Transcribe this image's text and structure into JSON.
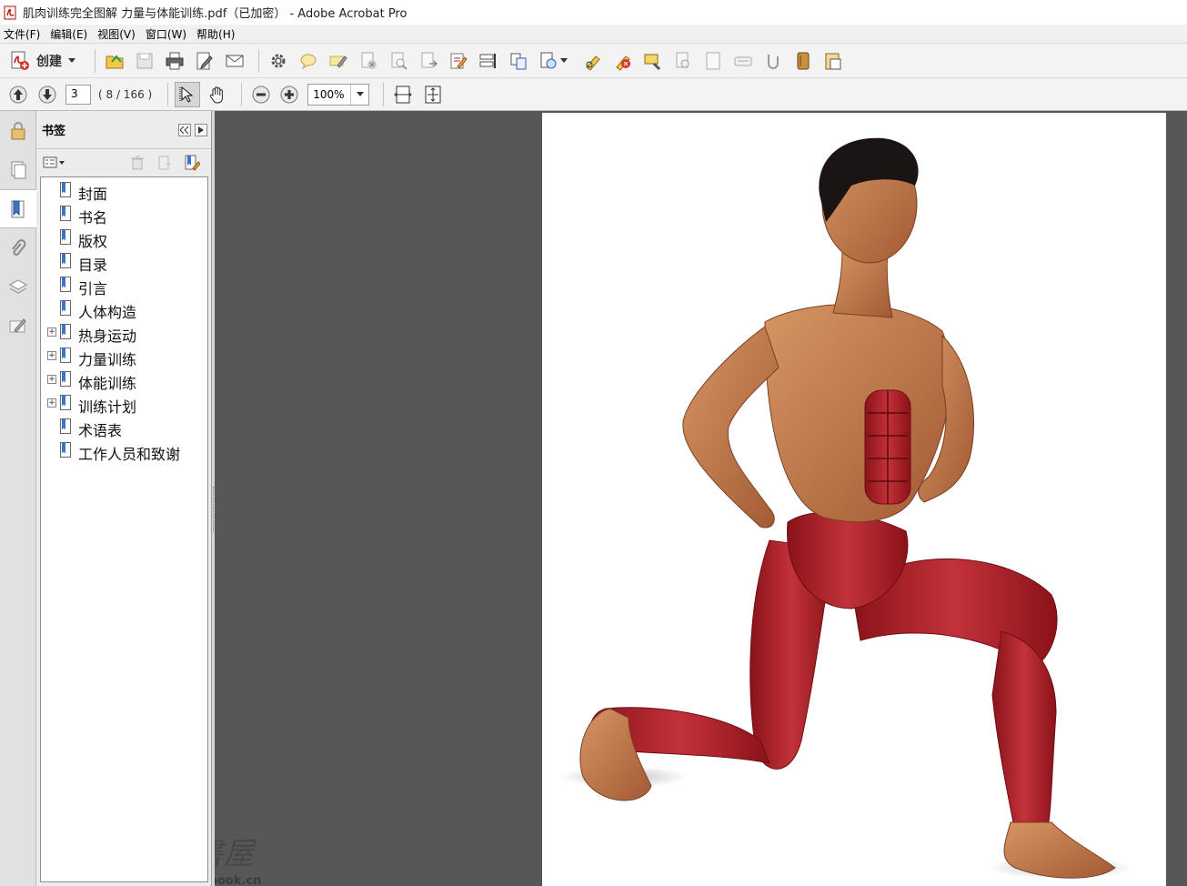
{
  "window": {
    "title": "肌肉训练完全图解 力量与体能训练.pdf（已加密） - Adobe Acrobat Pro"
  },
  "menu": [
    "文件(F)",
    "编辑(E)",
    "视图(V)",
    "窗口(W)",
    "帮助(H)"
  ],
  "toolbar": {
    "create_label": "创建"
  },
  "nav": {
    "page_input": "3",
    "page_count": "( 8 / 166 )",
    "zoom": "100%"
  },
  "bookmarks": {
    "title": "书签",
    "items": [
      {
        "label": "封面",
        "expandable": false
      },
      {
        "label": "书名",
        "expandable": false
      },
      {
        "label": "版权",
        "expandable": false
      },
      {
        "label": "目录",
        "expandable": false
      },
      {
        "label": "引言",
        "expandable": false
      },
      {
        "label": "人体构造",
        "expandable": false
      },
      {
        "label": "热身运动",
        "expandable": true
      },
      {
        "label": "力量训练",
        "expandable": true
      },
      {
        "label": "体能训练",
        "expandable": true
      },
      {
        "label": "训练计划",
        "expandable": true
      },
      {
        "label": "术语表",
        "expandable": false
      },
      {
        "label": "工作人员和致谢",
        "expandable": false
      }
    ]
  },
  "watermark": {
    "text": "PT書屋",
    "url": "www.ptbook.cn"
  },
  "colors": {
    "doc_bg": "#575757",
    "toolbar_bg": "#f3f3f3",
    "nav_bg": "#e1e1e1",
    "muscle": "#b0232a",
    "skin": "#c77a4c"
  }
}
